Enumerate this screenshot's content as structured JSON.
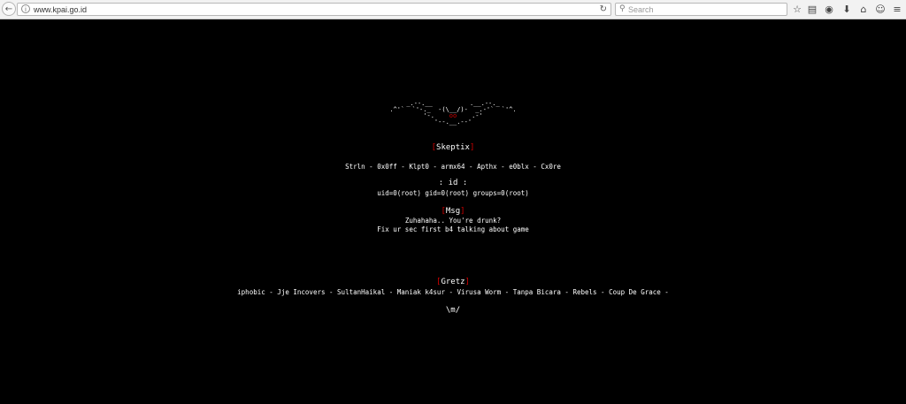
{
  "browser": {
    "url": "www.kpai.go.id",
    "search_placeholder": "Search"
  },
  "page": {
    "ascii_art": [
      "_.--.__          .__.--._",
      ".^'`  `'-._  -(\\__/)-  _.-'`  `'^.",
      "'-.    oo    .-'",
      "'--.__.--'"
    ],
    "ascii_eyes": "oo",
    "team_bracket_open": "[",
    "team_name": "Skeptix",
    "team_bracket_close": "]",
    "members": "Strln - 0x0ff - Klpt0 - armx64 - Apthx - e0blx - Cx0re",
    "id_heading": ": id :",
    "id_line": "uid=0(root) gid=0(root) groups=0(root)",
    "msg_bracket_open": "[",
    "msg_heading": "Msg",
    "msg_bracket_close": "]",
    "msg_line1": "Zuhahaha.. You're drunk?",
    "msg_line2": "Fix ur sec first b4 talking about game",
    "gretz_bracket_open": "[",
    "gretz_heading": "Gretz",
    "gretz_bracket_close": "]",
    "gretz_line": "iphobic - Jje Incovers - SultanHaikal - Maniak k4sur - Virusa Worm - Tanpa Bicara - Rebels - Coup De Grace -",
    "footer": "\\m/"
  }
}
